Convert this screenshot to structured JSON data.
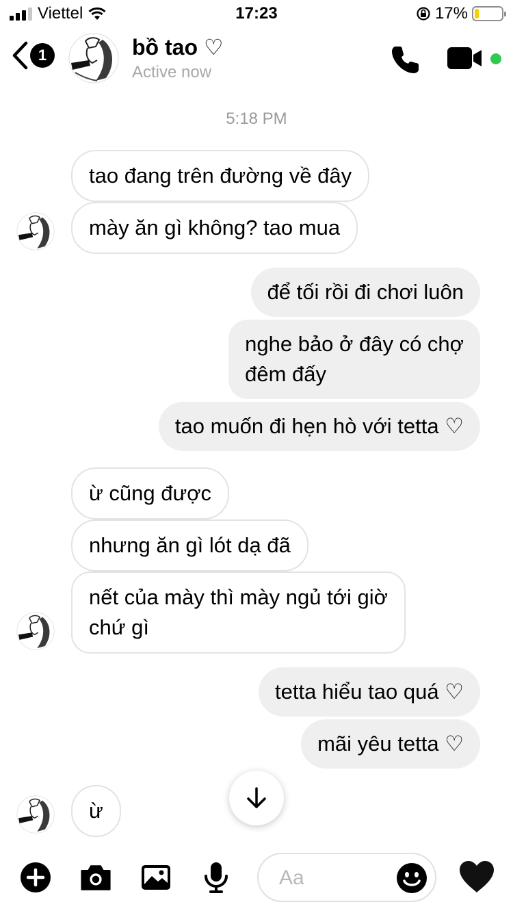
{
  "status_bar": {
    "carrier": "Viettel",
    "time": "17:23",
    "battery_percent": "17%",
    "battery_level": 0.17,
    "battery_color": "#f7d000"
  },
  "header": {
    "back_count": "1",
    "contact_name": "bồ tao ♡",
    "status": "Active now",
    "active_color": "#31c94f"
  },
  "timestamp": "5:18 PM",
  "messages": [
    {
      "from": "them",
      "text": "tao đang trên đường về đây"
    },
    {
      "from": "them",
      "text": "mày ăn gì không? tao mua"
    },
    {
      "from": "me",
      "text": "để tối rồi đi chơi luôn"
    },
    {
      "from": "me",
      "text": "nghe bảo ở đây có chợ",
      "text2": "đêm đấy"
    },
    {
      "from": "me",
      "text": "tao muốn đi hẹn hò với tetta ♡"
    },
    {
      "from": "them",
      "text": "ừ cũng được"
    },
    {
      "from": "them",
      "text": "nhưng ăn gì lót dạ đã"
    },
    {
      "from": "them",
      "text": "nết của mày thì mày ngủ tới giờ",
      "text2": "chứ gì"
    },
    {
      "from": "me",
      "text": "tetta hiểu tao quá ♡"
    },
    {
      "from": "me",
      "text": "mãi yêu tetta ♡"
    },
    {
      "from": "them",
      "text": "ừ"
    }
  ],
  "composer": {
    "placeholder": "Aa",
    "icons": [
      "plus-circle-icon",
      "camera-icon",
      "image-icon",
      "microphone-icon",
      "smiley-icon",
      "black-heart-icon"
    ]
  }
}
